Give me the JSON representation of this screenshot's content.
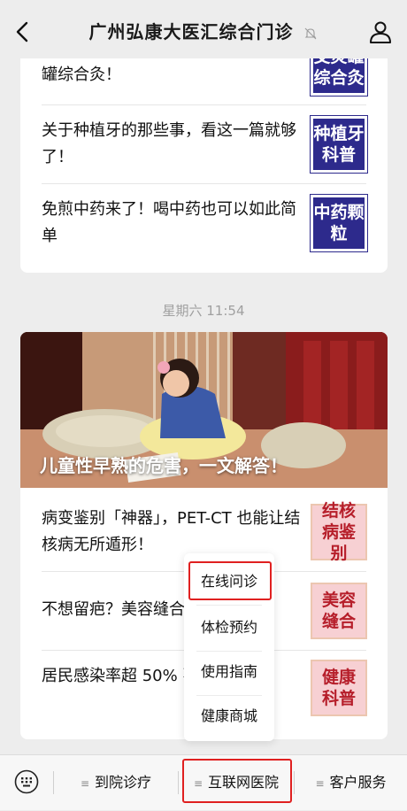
{
  "header": {
    "title": "广州弘康大医汇综合门诊"
  },
  "card1": {
    "rows": [
      {
        "text": "罐综合灸！",
        "thumb": "艾灸罐综合灸"
      },
      {
        "text": "关于种植牙的那些事，看这一篇就够了！",
        "thumb": "种植牙科普"
      },
      {
        "text": "免煎中药来了！喝中药也可以如此简单",
        "thumb": "中药颗粒"
      }
    ]
  },
  "timestamp": "星期六 11:54",
  "card2": {
    "hero_caption": "儿童性早熟的危害，一文解答！",
    "rows": [
      {
        "text": "病变鉴别「神器」，PET-CT 也能让结核病无所遁形！",
        "thumb": "结核病鉴别"
      },
      {
        "text": "不想留疤？美容缝合",
        "thumb": "美容缝合"
      },
      {
        "text": "居民感染率超 50% 不可忽视",
        "thumb": "健康科普"
      }
    ]
  },
  "popup_menu": {
    "items": [
      "在线问诊",
      "体检预约",
      "使用指南",
      "健康商城"
    ]
  },
  "tabbar": {
    "tabs": [
      "到院诊疗",
      "互联网医院",
      "客户服务"
    ]
  },
  "colors": {
    "highlight": "#e02020",
    "thumb_blue": "#2d2a8c",
    "thumb_pink": "#f7d0d3"
  }
}
